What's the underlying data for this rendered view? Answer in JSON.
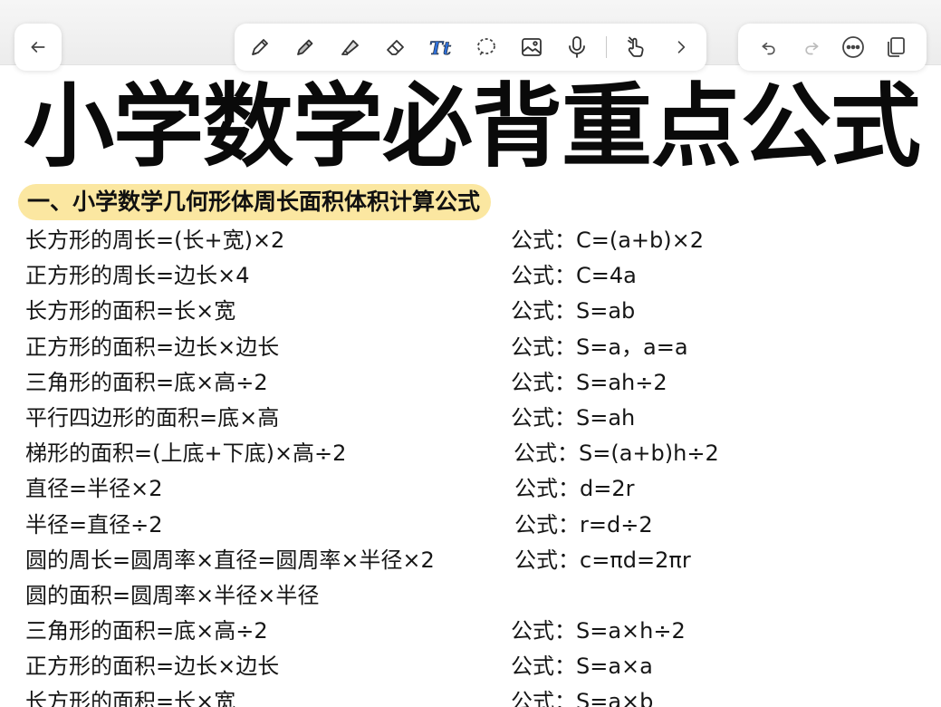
{
  "toolbar": {
    "back_icon": "arrow-left-icon",
    "tools": [
      {
        "name": "pen-icon"
      },
      {
        "name": "pencil-icon"
      },
      {
        "name": "highlighter-icon"
      },
      {
        "name": "eraser-icon"
      },
      {
        "name": "text-tool-icon",
        "label": "Tt"
      },
      {
        "name": "lasso-icon"
      },
      {
        "name": "image-icon"
      },
      {
        "name": "microphone-icon"
      },
      {
        "name": "touch-hand-icon"
      },
      {
        "name": "chevron-right-icon"
      }
    ],
    "actions": [
      "undo-icon",
      "redo-icon",
      "more-icon",
      "pages-icon"
    ]
  },
  "document": {
    "title": "小学数学必背重点公式",
    "section_heading": "一、小学数学几何形体周长面积体积计算公式",
    "rows": [
      {
        "left": "长方形的周长=(长+宽)×2",
        "right": "公式：C=(a+b)×2"
      },
      {
        "left": "正方形的周长=边长×4",
        "right": "公式：C=4a"
      },
      {
        "left": "长方形的面积=长×宽",
        "right": "公式：S=ab"
      },
      {
        "left": "正方形的面积=边长×边长",
        "right": "公式：S=a，a=a"
      },
      {
        "left": "三角形的面积=底×高÷2",
        "right": "公式：S=ah÷2"
      },
      {
        "left": "平行四边形的面积=底×高",
        "right": "公式：S=ah"
      },
      {
        "left": "梯形的面积=(上底+下底)×高÷2",
        "right": "公式：S=(a+b)h÷2"
      },
      {
        "left": "直径=半径×2",
        "right": "公式：d=2r"
      },
      {
        "left": "半径=直径÷2",
        "right": "公式：r=d÷2"
      },
      {
        "left": "圆的周长=圆周率×直径=圆周率×半径×2",
        "right": "公式：c=πd=2πr"
      },
      {
        "left": "圆的面积=圆周率×半径×半径",
        "right": ""
      },
      {
        "left": "三角形的面积=底×高÷2",
        "right": "公式：S=a×h÷2"
      },
      {
        "left": "正方形的面积=边长×边长",
        "right": "公式：S=a×a"
      },
      {
        "left": "长方形的面积=长×宽",
        "right": "公式：S=a×b"
      }
    ]
  },
  "colors": {
    "section_highlight": "#fbe7a1",
    "text": "#161616",
    "toolbar_bg": "#ececec"
  }
}
